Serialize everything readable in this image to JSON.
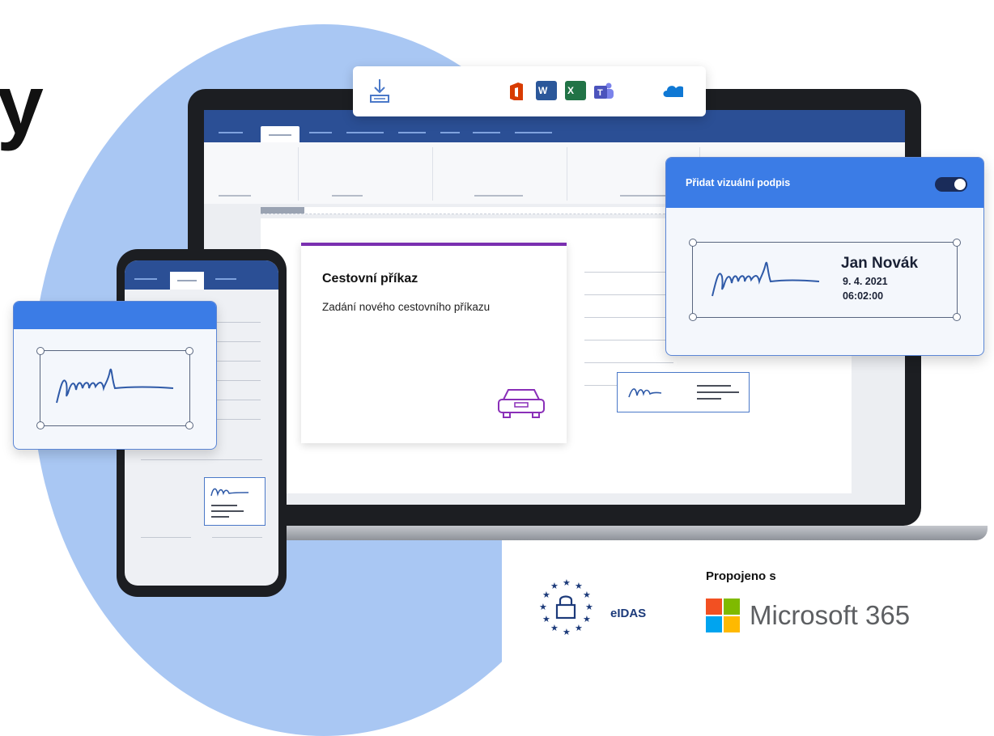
{
  "headline": {
    "visible_fragment": "y"
  },
  "toolbar": {
    "icons": [
      "download-icon",
      "office-icon",
      "word-icon",
      "excel-icon",
      "teams-icon",
      "onedrive-icon"
    ],
    "word_letter": "W",
    "excel_letter": "X"
  },
  "document_card": {
    "title": "Cestovní příkaz",
    "subtitle": "Zadání nového cestovního příkazu",
    "icon": "car-icon",
    "accent_color": "#7a2fb0"
  },
  "signature_panel": {
    "title": "Přidat vizuální podpis",
    "toggle_on": true,
    "signer_name": "Jan Novák",
    "date": "9. 4. 2021",
    "time": "06:02:00",
    "header_color": "#3b7ce6"
  },
  "footer": {
    "connected_label": "Propojeno s",
    "product_name": "Microsoft 365",
    "eidas_label": "eIDAS"
  },
  "colors": {
    "ribbon": "#2b4f95",
    "blob": "#a9c7f3",
    "signature_ink": "#2f5aa8"
  }
}
